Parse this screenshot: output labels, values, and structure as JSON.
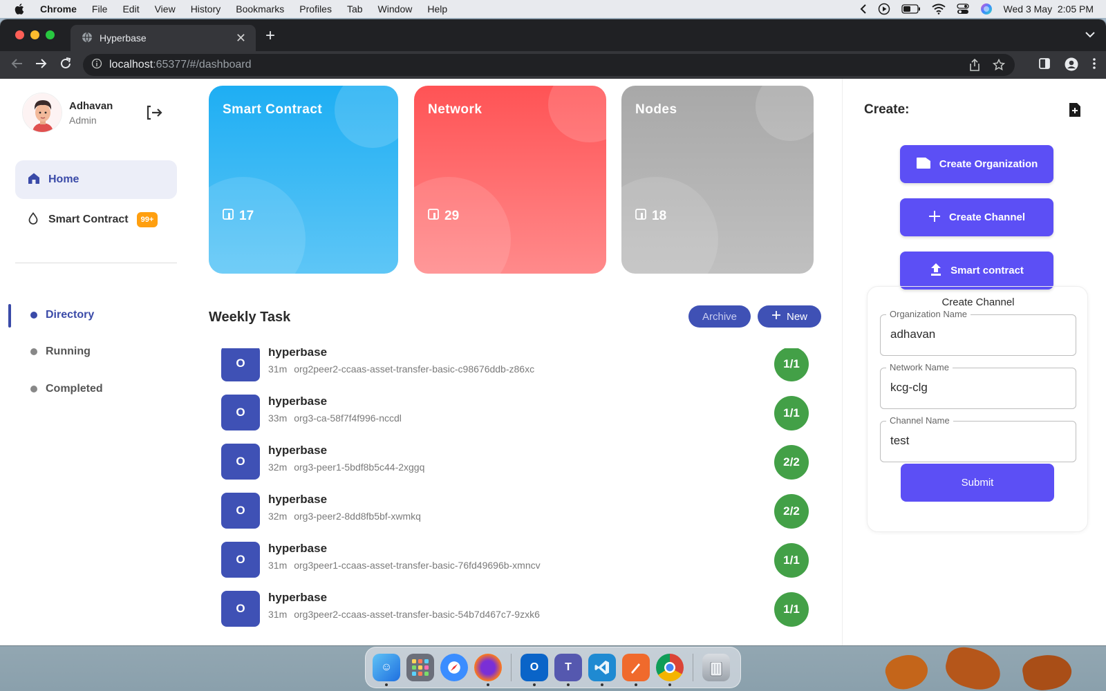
{
  "menubar": {
    "app": "Chrome",
    "items": [
      "File",
      "Edit",
      "View",
      "History",
      "Bookmarks",
      "Profiles",
      "Tab",
      "Window",
      "Help"
    ],
    "datetime": "Wed 3 May  2:05 PM"
  },
  "browser": {
    "tab_title": "Hyperbase",
    "url_host": "localhost",
    "url_path": ":65377/#/dashboard"
  },
  "sidebar": {
    "user_name": "Adhavan",
    "user_role": "Admin",
    "nav": [
      {
        "label": "Home",
        "active": true
      },
      {
        "label": "Smart Contract",
        "badge": "99+"
      }
    ],
    "dirs": [
      {
        "label": "Directory",
        "active": true
      },
      {
        "label": "Running"
      },
      {
        "label": "Completed"
      }
    ]
  },
  "cards": [
    {
      "title": "Smart Contract",
      "count": "17"
    },
    {
      "title": "Network",
      "count": "29"
    },
    {
      "title": "Nodes",
      "count": "18"
    }
  ],
  "weekly": {
    "title": "Weekly Task",
    "archive_label": "Archive",
    "new_label": "New",
    "tasks": [
      {
        "initial": "O",
        "name": "hyperbase",
        "age": "31m",
        "id": "org2peer2-ccaas-asset-transfer-basic-c98676ddb-z86xc",
        "ratio": "1/1"
      },
      {
        "initial": "O",
        "name": "hyperbase",
        "age": "33m",
        "id": "org3-ca-58f7f4f996-nccdl",
        "ratio": "1/1"
      },
      {
        "initial": "O",
        "name": "hyperbase",
        "age": "32m",
        "id": "org3-peer1-5bdf8b5c44-2xggq",
        "ratio": "2/2"
      },
      {
        "initial": "O",
        "name": "hyperbase",
        "age": "32m",
        "id": "org3-peer2-8dd8fb5bf-xwmkq",
        "ratio": "2/2"
      },
      {
        "initial": "O",
        "name": "hyperbase",
        "age": "31m",
        "id": "org3peer1-ccaas-asset-transfer-basic-76fd49696b-xmncv",
        "ratio": "1/1"
      },
      {
        "initial": "O",
        "name": "hyperbase",
        "age": "31m",
        "id": "org3peer2-ccaas-asset-transfer-basic-54b7d467c7-9zxk6",
        "ratio": "1/1"
      }
    ]
  },
  "create": {
    "title": "Create:",
    "buttons": [
      "Create Organization",
      "Create Channel",
      "Smart contract"
    ],
    "form": {
      "title": "Create Channel",
      "org_label": "Organization Name",
      "org_value": "adhavan",
      "net_label": "Network Name",
      "net_value": "kcg-clg",
      "chan_label": "Channel Name",
      "chan_value": "test",
      "submit_label": "Submit"
    }
  },
  "colors": {
    "primary": "#3f51b5",
    "accent": "#5c4ff5",
    "success": "#43a047",
    "card_blue": "#1eaef3",
    "card_red": "#ff5355",
    "card_gray": "#a8a8a8",
    "badge": "#ff9f0f"
  }
}
